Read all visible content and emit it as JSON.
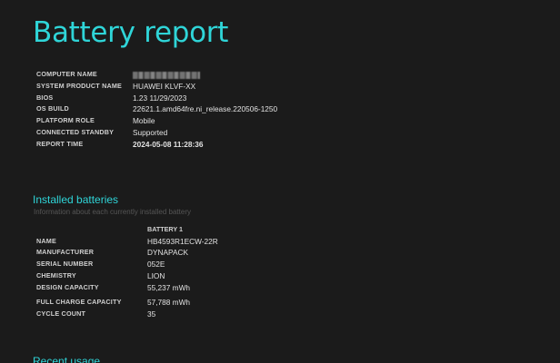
{
  "header": {
    "title": "Battery report"
  },
  "system_info": [
    {
      "label": "COMPUTER NAME",
      "value": ""
    },
    {
      "label": "SYSTEM PRODUCT NAME",
      "value": "HUAWEI KLVF-XX"
    },
    {
      "label": "BIOS",
      "value": "1.23 11/29/2023"
    },
    {
      "label": "OS BUILD",
      "value": "22621.1.amd64fre.ni_release.220506-1250"
    },
    {
      "label": "PLATFORM ROLE",
      "value": "Mobile"
    },
    {
      "label": "CONNECTED STANDBY",
      "value": "Supported"
    },
    {
      "label": "REPORT TIME",
      "value": "2024-05-08  11:28:36"
    }
  ],
  "installed_batteries": {
    "title": "Installed batteries",
    "subtitle": "Information about each currently installed battery",
    "column_header": "BATTERY 1",
    "rows": [
      {
        "label": "NAME",
        "value": "HB4593R1ECW-22R"
      },
      {
        "label": "MANUFACTURER",
        "value": "DYNAPACK"
      },
      {
        "label": "SERIAL NUMBER",
        "value": "052E"
      },
      {
        "label": "CHEMISTRY",
        "value": "LION"
      },
      {
        "label": "DESIGN CAPACITY",
        "value": "55,237 mWh"
      },
      {
        "label": "FULL CHARGE CAPACITY",
        "value": "57,788 mWh"
      },
      {
        "label": "CYCLE COUNT",
        "value": "35"
      }
    ]
  },
  "recent_usage": {
    "title": "Recent usage"
  },
  "colors": {
    "accent": "#2fd5d8",
    "background": "#1b1b1b",
    "text": "#d8d8d8"
  }
}
